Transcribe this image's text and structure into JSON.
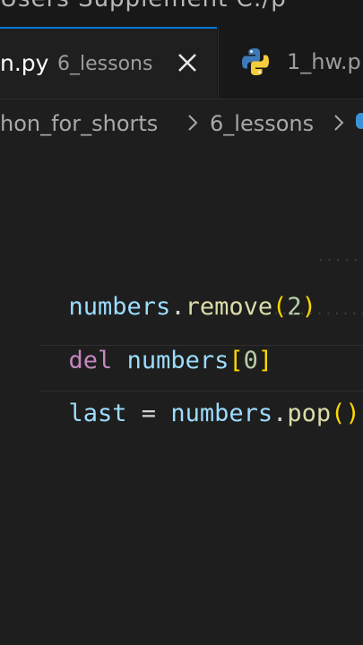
{
  "top_strip": {
    "text": "Users   Supplement   C:/p"
  },
  "tabs": [
    {
      "label": "n.py",
      "description": "6_lessons",
      "active": true
    },
    {
      "label": "1_hw.p",
      "active": false,
      "icon": "python-icon"
    }
  ],
  "breadcrumb": [
    "hon_for_shorts",
    "6_lessons"
  ],
  "code_lines": [
    {
      "tokens": [
        {
          "t": "numbers",
          "c": "var"
        },
        {
          "t": ".",
          "c": "op"
        },
        {
          "t": "remove",
          "c": "fn"
        },
        {
          "t": "(",
          "c": "paren"
        },
        {
          "t": "2",
          "c": "num"
        },
        {
          "t": ")",
          "c": "paren"
        }
      ]
    },
    {
      "tokens": [
        {
          "t": "del",
          "c": "kw"
        },
        {
          "t": " ",
          "c": "op"
        },
        {
          "t": "numbers",
          "c": "var"
        },
        {
          "t": "[",
          "c": "paren"
        },
        {
          "t": "0",
          "c": "num"
        },
        {
          "t": "]",
          "c": "paren"
        }
      ]
    },
    {
      "tokens": [
        {
          "t": "last",
          "c": "var"
        },
        {
          "t": " = ",
          "c": "op"
        },
        {
          "t": "numbers",
          "c": "var"
        },
        {
          "t": ".",
          "c": "op"
        },
        {
          "t": "pop",
          "c": "fn"
        },
        {
          "t": "()",
          "c": "paren"
        }
      ]
    }
  ],
  "colors": {
    "background": "#1e1e1e",
    "accent": "#0078d4",
    "variable": "#9cdcfe",
    "function": "#dcdcaa",
    "number": "#b5cea8",
    "keyword": "#c586c0",
    "bracket": "#ffd700"
  }
}
